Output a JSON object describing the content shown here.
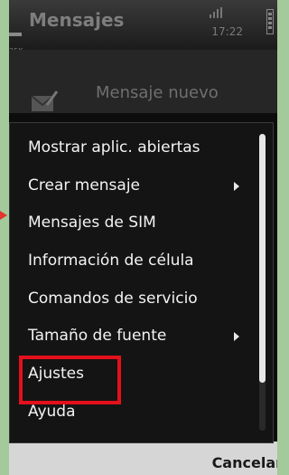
{
  "header": {
    "title": "Mensajes",
    "time": "17:22",
    "left_small_text": "35K"
  },
  "background": {
    "item_label": "Mensaje nuevo"
  },
  "menu": {
    "items": [
      {
        "label": "Mostrar aplic. abiertas",
        "submenu": false
      },
      {
        "label": "Crear mensaje",
        "submenu": true
      },
      {
        "label": "Mensajes de SIM",
        "submenu": false
      },
      {
        "label": "Información de célula",
        "submenu": false
      },
      {
        "label": "Comandos de servicio",
        "submenu": false
      },
      {
        "label": "Tamaño de fuente",
        "submenu": true
      },
      {
        "label": "Ajustes",
        "submenu": false
      },
      {
        "label": "Ayuda",
        "submenu": false
      }
    ],
    "highlighted_item": "Ajustes"
  },
  "softkeys": {
    "right_label": "Cancelar"
  },
  "colors": {
    "accent_highlight": "#e3101b",
    "page_bg": "#a4c99a"
  }
}
